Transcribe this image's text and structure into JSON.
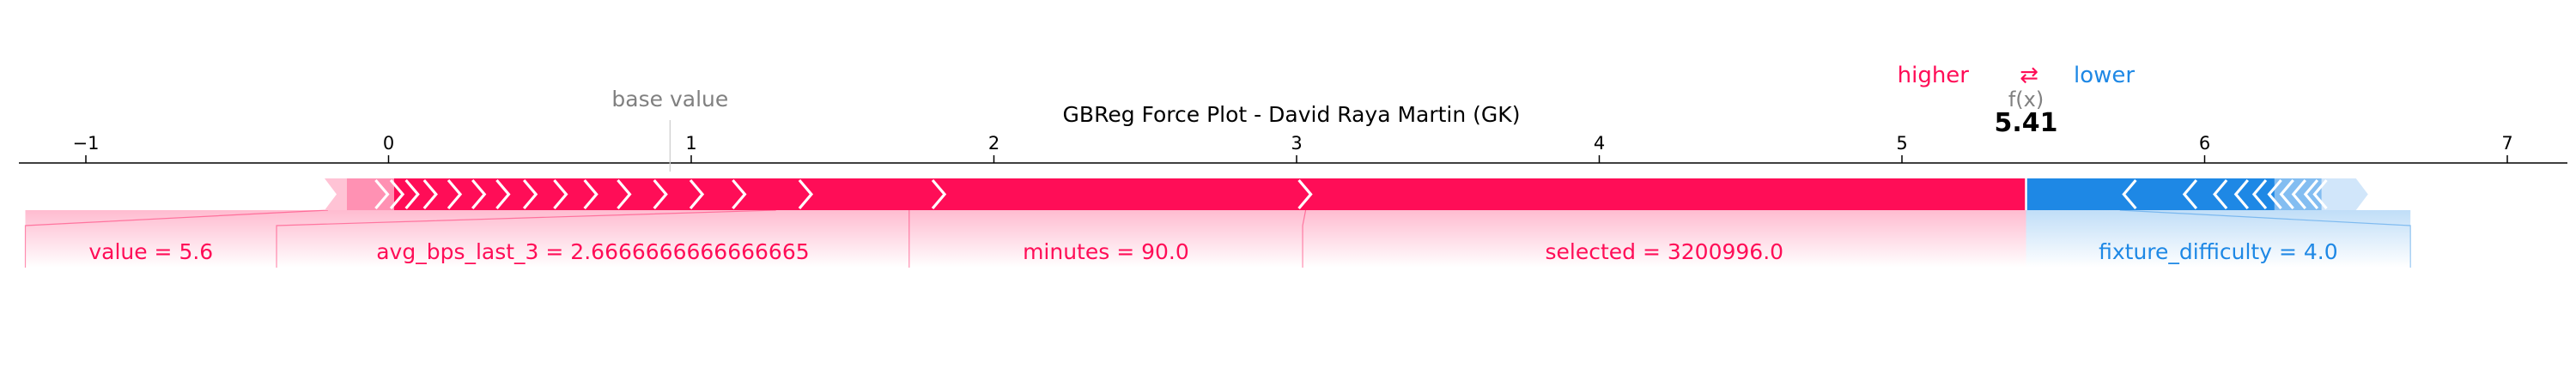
{
  "chart_data": {
    "type": "force",
    "title": "GBReg Force Plot - David Raya Martin (GK)",
    "base_value": 0.93,
    "output_value": 5.41,
    "output_label": "5.41",
    "fx_label": "f(x)",
    "base_value_label": "base value",
    "legend": {
      "higher": "higher",
      "lower": "lower",
      "arrow": "⇄"
    },
    "xlim": [
      -1.2,
      7.2
    ],
    "ticks": [
      {
        "value": -1,
        "label": "−1"
      },
      {
        "value": 0,
        "label": "0"
      },
      {
        "value": 1,
        "label": "1"
      },
      {
        "value": 2,
        "label": "2"
      },
      {
        "value": 3,
        "label": "3"
      },
      {
        "value": 4,
        "label": "4"
      },
      {
        "value": 5,
        "label": "5"
      },
      {
        "value": 6,
        "label": "6"
      },
      {
        "value": 7,
        "label": "7"
      }
    ],
    "positive_range": [
      -0.2,
      5.41
    ],
    "negative_range": [
      5.41,
      6.5
    ],
    "positive_boundaries": [
      -0.02,
      0.03,
      0.08,
      0.14,
      0.22,
      0.3,
      0.38,
      0.47,
      0.57,
      0.67,
      0.78,
      0.9,
      1.02,
      1.16,
      1.38,
      1.82,
      3.03
    ],
    "negative_boundaries": [
      5.75,
      5.95,
      6.05,
      6.12,
      6.18,
      6.23,
      6.27,
      6.31,
      6.35,
      6.38
    ],
    "positive_features": [
      {
        "label": "value = 5.6",
        "start": -0.2,
        "end": -0.03
      },
      {
        "label": "avg_bps_last_3 = 2.6666666666666665",
        "start": 1.28,
        "end": 1.72
      },
      {
        "label": "minutes = 90.0",
        "start": 1.72,
        "end": 3.03
      },
      {
        "label": "selected = 3200996.0",
        "start": 3.03,
        "end": 5.41
      }
    ],
    "negative_features": [
      {
        "label": "fixture_difficulty = 4.0",
        "start": 5.41,
        "end": 5.72
      }
    ],
    "colors": {
      "positive": "#ff0d57",
      "negative": "#1e88e5",
      "positive_light": "#ffc3d5",
      "negative_light": "#d1e6fa",
      "axis": "#000000",
      "muted": "#808080"
    }
  }
}
